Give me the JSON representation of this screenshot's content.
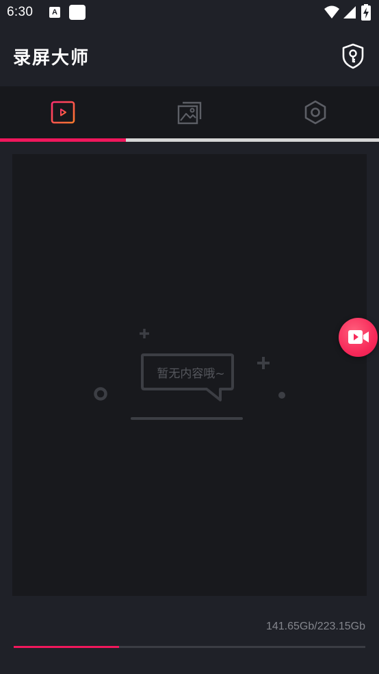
{
  "status_bar": {
    "time": "6:30",
    "a_icon_letter": "A",
    "icons": [
      "a-notification-icon",
      "square-notification-icon",
      "wifi-icon",
      "signal-icon",
      "battery-icon"
    ]
  },
  "header": {
    "title": "录屏大师",
    "action_icon": "shield-keyhole-icon"
  },
  "tabs": [
    {
      "icon": "video-film-icon",
      "active": true
    },
    {
      "icon": "image-gallery-icon",
      "active": false
    },
    {
      "icon": "settings-hexagon-icon",
      "active": false
    }
  ],
  "tab_indicator": {
    "active_index": 0,
    "fraction": 0.333
  },
  "content": {
    "empty_message": "暂无内容哦~"
  },
  "fab": {
    "icon": "video-camera-icon"
  },
  "storage": {
    "text": "141.65Gb/223.15Gb",
    "used_fraction": 0.3
  },
  "colors": {
    "accent": "#f0175c",
    "background": "#1f2128",
    "panel": "#18191d",
    "tab_bar": "#17181c"
  }
}
